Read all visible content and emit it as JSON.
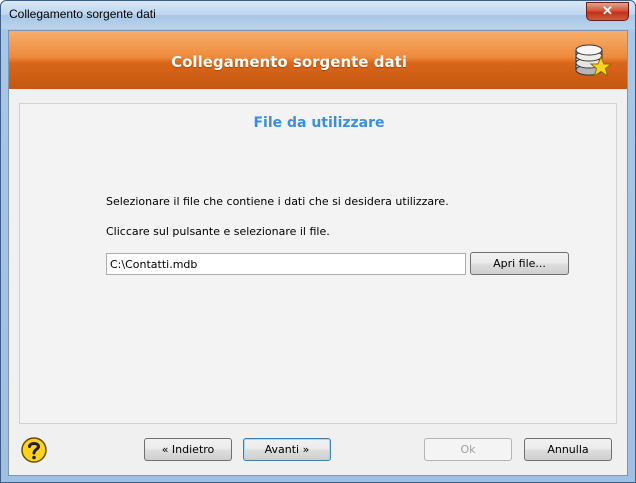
{
  "window": {
    "title": "Collegamento sorgente dati",
    "close_glyph": "✕"
  },
  "banner": {
    "title": "Collegamento sorgente dati",
    "icon": "database-star-icon"
  },
  "main": {
    "section_title": "File da utilizzare",
    "instruction_1": "Selezionare il file che contiene i dati che si desidera utilizzare.",
    "instruction_2": "Cliccare sul pulsante e selezionare il file.",
    "file_path_value": "C:\\Contatti.mdb",
    "open_file_label": "Apri file..."
  },
  "footer": {
    "help_icon": "help-question-icon",
    "back_label": "« Indietro",
    "next_label": "Avanti »",
    "ok_label": "Ok",
    "cancel_label": "Annulla"
  },
  "colors": {
    "banner_orange": "#ee8a3c",
    "section_title_blue": "#3a8ee6",
    "close_red": "#c2311a"
  }
}
